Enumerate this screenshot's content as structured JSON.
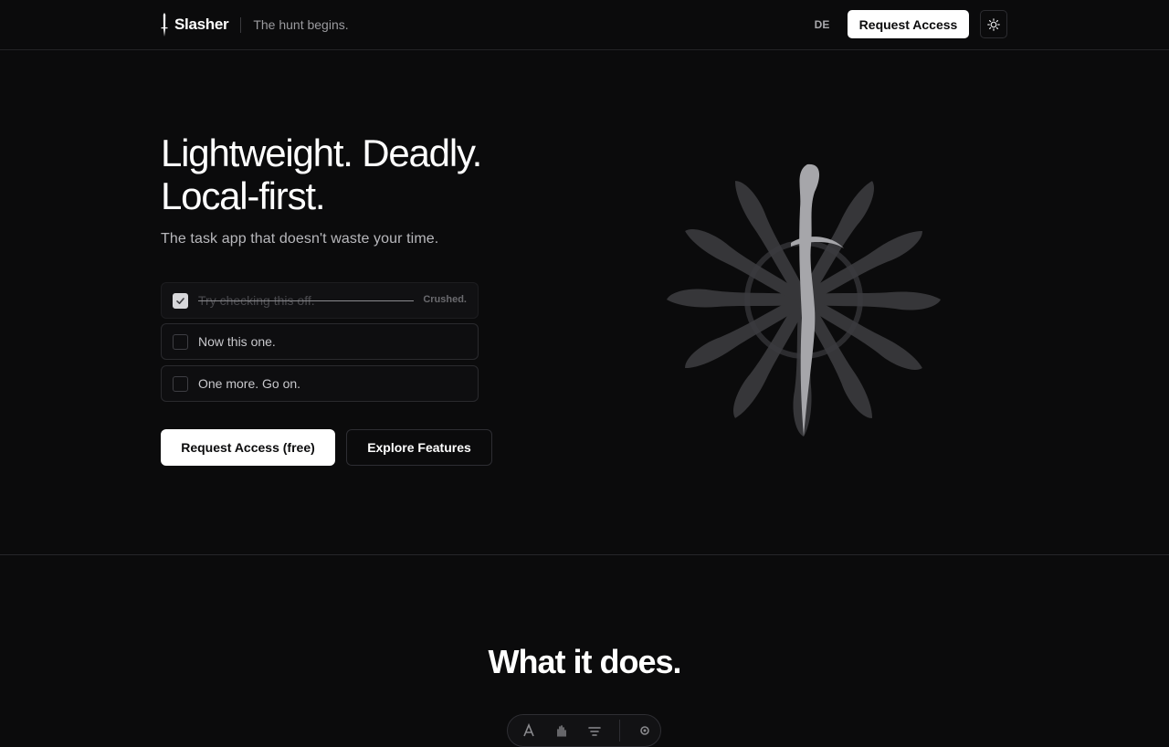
{
  "header": {
    "brand_name": "Slasher",
    "tagline": "The hunt begins.",
    "lang_label": "DE",
    "cta_label": "Request Access",
    "theme_icon": "sun-icon"
  },
  "hero": {
    "title_line1": "Lightweight. Deadly.",
    "title_line2": "Local-first.",
    "subtitle": "The task app that doesn't waste your time.",
    "tasks": [
      {
        "label": "Try checking this off.",
        "checked": true,
        "status": "Crushed."
      },
      {
        "label": "Now this one.",
        "checked": false
      },
      {
        "label": "One more. Go on.",
        "checked": false
      }
    ],
    "primary_button": "Request Access (free)",
    "secondary_button": "Explore Features",
    "art_icon": "dagger-swirl-icon"
  },
  "features": {
    "title": "What it does.",
    "bar_icons": [
      "text-icon",
      "hand-icon",
      "filter-icon",
      "gear-icon"
    ]
  },
  "colors": {
    "background": "#0b0b0c",
    "primary": "#ffffff",
    "muted": "#9a9a9e"
  }
}
